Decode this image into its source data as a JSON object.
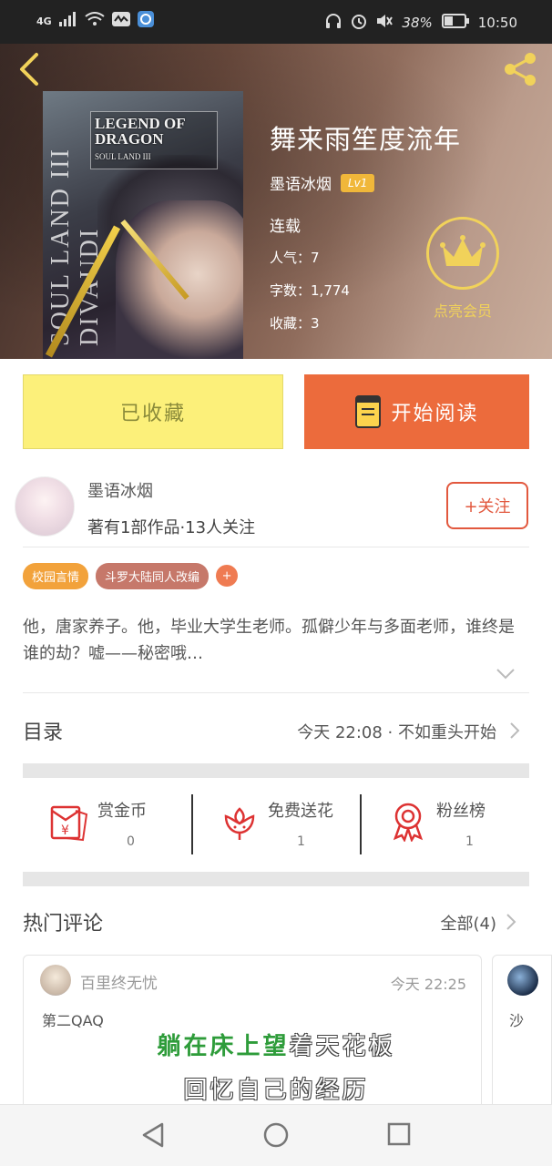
{
  "status_bar": {
    "network": "4G",
    "battery": "38%",
    "time": "10:50"
  },
  "book": {
    "cover_title": "LEGEND OF DRAGON",
    "cover_subtitle": "SOUL LAND III",
    "cover_side_text": "SOUL LAND III DIVAUDI",
    "title": "舞来雨笙度流年",
    "author": "墨语冰烟",
    "author_level": "Lv1",
    "status": "连载",
    "stats": {
      "popularity_label": "人气：",
      "popularity": "7",
      "words_label": "字数：",
      "words": "1,774",
      "favorites_label": "收藏：",
      "favorites": "3"
    },
    "vip_label": "点亮会员"
  },
  "buttons": {
    "collected": "已收藏",
    "start_reading": "开始阅读"
  },
  "author_info": {
    "name": "墨语冰烟",
    "meta": "著有1部作品·13人关注",
    "follow": "+关注"
  },
  "tags": [
    "校园言情",
    "斗罗大陆同人改编",
    "+"
  ],
  "description": "他，唐家养子。他，毕业大学生老师。孤僻少年与多面老师，谁终是谁的劫？嘘——秘密哦…",
  "toc": {
    "label": "目录",
    "latest": "今天 22:08 · 不如重头开始"
  },
  "actions": [
    {
      "label": "赏金币",
      "count": "0",
      "icon": "red-envelope-icon"
    },
    {
      "label": "免费送花",
      "count": "1",
      "icon": "flower-icon"
    },
    {
      "label": "粉丝榜",
      "count": "1",
      "icon": "medal-icon"
    }
  ],
  "hot_comments": {
    "label": "热门评论",
    "all": "全部(4)",
    "items": [
      {
        "user": "百里终无忧",
        "time": "今天  22:25",
        "text": "第二QAQ"
      },
      {
        "user": "",
        "time": "",
        "text": "沙"
      }
    ]
  },
  "overlay": {
    "line1_green": "躺在床上望",
    "line1_white": "着天花板",
    "line2": "回忆自己的经历"
  },
  "colors": {
    "accent_orange": "#ec6b3c",
    "collected_yellow": "#fcf07a",
    "vip_gold": "#f1d25a",
    "tag_orange": "#f2a23b",
    "tag_brown": "#c6786a",
    "follow_red": "#e2583e"
  }
}
